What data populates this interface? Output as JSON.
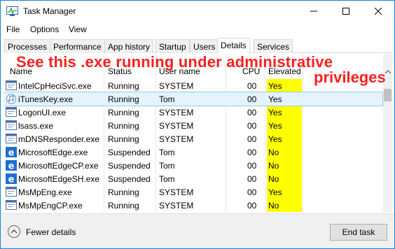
{
  "window": {
    "title": "Task Manager"
  },
  "menu": [
    "File",
    "Options",
    "View"
  ],
  "tabs": [
    "Processes",
    "Performance",
    "App history",
    "Startup",
    "Users",
    "Details",
    "Services"
  ],
  "active_tab": "Details",
  "columns": {
    "name": "Name",
    "status": "Status",
    "user": "User name",
    "cpu": "CPU",
    "elevated": "Elevated"
  },
  "rows": [
    {
      "name": "IntelCpHeciSvc.exe",
      "status": "Running",
      "user": "SYSTEM",
      "cpu": "00",
      "elevated": "Yes",
      "icon": "app-window-icon"
    },
    {
      "name": "iTunesKey.exe",
      "status": "Running",
      "user": "Tom",
      "cpu": "00",
      "elevated": "Yes",
      "icon": "itunes-icon",
      "selected": true
    },
    {
      "name": "LogonUI.exe",
      "status": "Running",
      "user": "SYSTEM",
      "cpu": "00",
      "elevated": "Yes",
      "icon": "app-window-icon"
    },
    {
      "name": "lsass.exe",
      "status": "Running",
      "user": "SYSTEM",
      "cpu": "00",
      "elevated": "Yes",
      "icon": "app-window-icon"
    },
    {
      "name": "mDNSResponder.exe",
      "status": "Running",
      "user": "SYSTEM",
      "cpu": "00",
      "elevated": "Yes",
      "icon": "app-window-icon"
    },
    {
      "name": "MicrosoftEdge.exe",
      "status": "Suspended",
      "user": "Tom",
      "cpu": "00",
      "elevated": "No",
      "icon": "edge-icon"
    },
    {
      "name": "MicrosoftEdgeCP.exe",
      "status": "Suspended",
      "user": "Tom",
      "cpu": "00",
      "elevated": "No",
      "icon": "edge-icon"
    },
    {
      "name": "MicrosoftEdgeSH.exe",
      "status": "Suspended",
      "user": "Tom",
      "cpu": "00",
      "elevated": "No",
      "icon": "edge-icon"
    },
    {
      "name": "MsMpEng.exe",
      "status": "Running",
      "user": "SYSTEM",
      "cpu": "00",
      "elevated": "Yes",
      "icon": "app-window-icon"
    },
    {
      "name": "MsMpEngCP.exe",
      "status": "Running",
      "user": "SYSTEM",
      "cpu": "00",
      "elevated": "No",
      "icon": "app-window-icon"
    }
  ],
  "annotation": {
    "line1": "See this .exe running under administrative",
    "line2": "privileges"
  },
  "footer": {
    "fewer_details": "Fewer details",
    "end_task": "End task"
  },
  "colors": {
    "accent": "#1883d7",
    "highlight": "#ffff00",
    "annotation": "#ff1f1f",
    "selection": "#e5f3ff",
    "edge_blue": "#1f6fd1"
  }
}
